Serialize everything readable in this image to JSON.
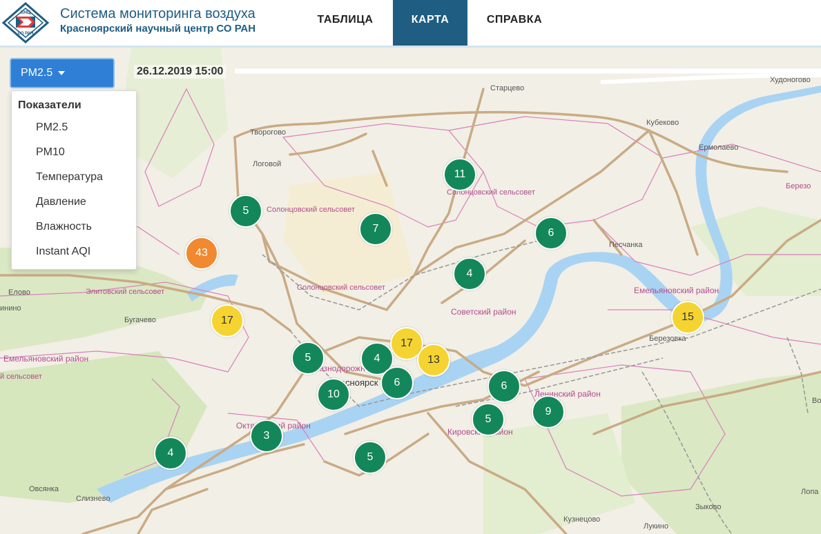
{
  "header": {
    "logo_text_top": "КНЦ",
    "logo_text_bottom": "СО РАН",
    "title": "Система мониторинга воздуха",
    "subtitle": "Красноярский научный центр СО РАН",
    "nav": {
      "table": "ТАБЛИЦА",
      "map": "КАРТА",
      "help": "СПРАВКА"
    }
  },
  "controls": {
    "selected_metric": "PM2.5",
    "datetime": "26.12.2019 15:00",
    "menu_header": "Показатели",
    "menu_items": [
      "PM2.5",
      "PM10",
      "Температура",
      "Давление",
      "Влажность",
      "Instant AQI"
    ]
  },
  "colors": {
    "good": "#13875a",
    "moderate": "#f5d431",
    "unhealthy_sensitive": "#f0892f",
    "brand": "#1f5d82",
    "button": "#2f7fd6"
  },
  "markers": [
    "11",
    "5",
    "7",
    "6",
    "43",
    "4",
    "17",
    "15",
    "5",
    "4",
    "17",
    "13",
    "6",
    "10",
    "6",
    "5",
    "9",
    "3",
    "4",
    "5"
  ],
  "map_labels": {
    "starcevo": "Старцево",
    "hudonogovo": "Худоногово",
    "kubekovo": "Кубеково",
    "ermolaevo": "Ермолаево",
    "berezo": "Березо",
    "tvorogovo": "Творогово",
    "logovoy": "Логовой",
    "solontsy_ss1": "Солонцовский сельсовет",
    "solontsy_ss2": "Солонцовский сельсовет",
    "solontsy_ss3": "Солонцовский сельсовет",
    "elitovskiy": "Элитовский сельсовет",
    "sovetskiy": "Советский район",
    "peschanka": "Песчанка",
    "emelyanovskiy1": "Емельяновский район",
    "emelyanovskiy2": "Емельяновский район",
    "berezovka": "Березовка",
    "bugachevo": "Бугачево",
    "elovoe": "Елово",
    "inino": "инино",
    "selsovet": "й сельсовет",
    "krasnoyarsk": "Красноярск",
    "zheleznodor": "Железнодорожный",
    "leninskiy": "Ленинский район",
    "kirovskiy": "Кировский район",
    "oktyabrskiy": "Октябрьский район",
    "ovsyanka": "Овсянка",
    "sliznevo": "Слизнево",
    "kuznetsovo": "Кузнецово",
    "lukino": "Лукино",
    "zykovo": "Зыково",
    "lopa": "Лопа",
    "vo": "Во"
  }
}
